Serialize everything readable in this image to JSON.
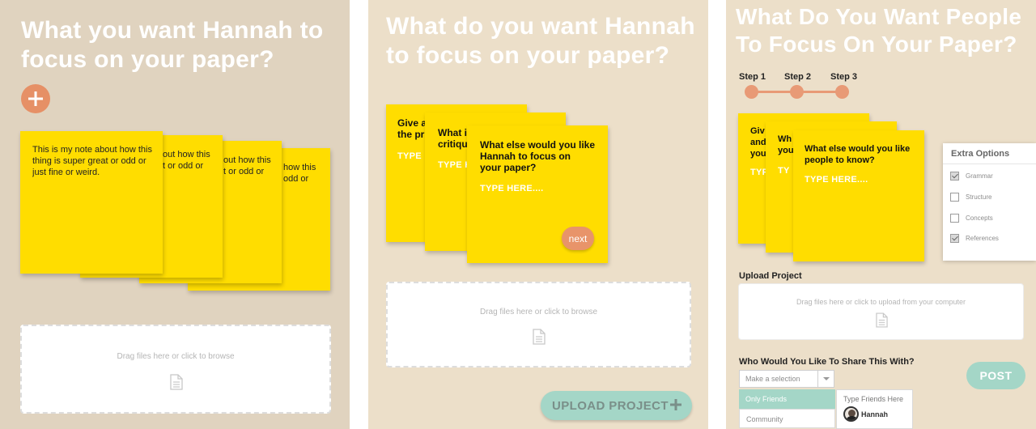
{
  "panel1": {
    "title_line1": "What you want Hannah to",
    "title_line2": "focus on your paper?",
    "notes": [
      {
        "line1": "This is my note about how this",
        "line2": "thing is super great or odd or",
        "line3": "just fine or weird."
      },
      {
        "line1": "out how this",
        "line2": "t or odd or"
      },
      {
        "line1": "out how this",
        "line2": "t or odd or"
      },
      {
        "line1": "how this",
        "line2": "odd or"
      }
    ],
    "dropzone_text": "Drag files here or click to browse",
    "icons": {
      "add": "plus-icon",
      "file": "document-icon"
    }
  },
  "panel2": {
    "title_line1": "What do you want Hannah",
    "title_line2": "to focus on your paper?",
    "card_back": {
      "q1": "Give a",
      "q2": "the pr",
      "type": "TYPE"
    },
    "card_mid": {
      "q1": "What i",
      "q2": "critiqu",
      "type": "TYPE H"
    },
    "card_front": {
      "q1": "What else would you like",
      "q2": "Hannah to focus on",
      "q3": "your paper?",
      "type": "TYPE HERE...."
    },
    "next_label": "next",
    "dropzone_text": "Drag files here or click to browse",
    "upload_label": "UPLOAD PROJECT",
    "upload_icon": "plus-icon"
  },
  "panel3": {
    "title_line1": "What Do You Want People",
    "title_line2": "To Focus On Your Paper?",
    "steps": [
      "Step 1",
      "Step 2",
      "Step 3"
    ],
    "card_back": {
      "q1": "Giv",
      "q2": "and",
      "q3": "you",
      "type": "TYP"
    },
    "card_mid": {
      "q1": "Wh",
      "q2": "you",
      "type": "TY"
    },
    "card_front": {
      "q1": "What else would you like",
      "q2": "people to know?",
      "type": "TYPE HERE...."
    },
    "extra_options": {
      "title": "Extra Options",
      "items": [
        {
          "label": "Grammar",
          "checked": true
        },
        {
          "label": "Structure",
          "checked": false
        },
        {
          "label": "Concepts",
          "checked": false
        },
        {
          "label": "References",
          "checked": true
        }
      ]
    },
    "upload_label": "Upload Project",
    "dropzone_text": "Drag files here or click to upload from your computer",
    "share_label": "Who Would You Like To Share This With?",
    "select_placeholder": "Make a selection",
    "options": [
      "Only Friends",
      "Community"
    ],
    "friends_placeholder": "Type Friends Here",
    "friend_name": "Hannah",
    "post_label": "POST"
  }
}
